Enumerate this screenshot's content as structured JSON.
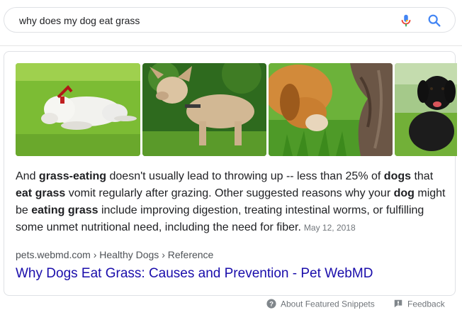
{
  "search": {
    "query": "why does my dog eat grass",
    "mic_icon": "microphone-icon",
    "search_icon": "magnifier-icon",
    "colors": {
      "mic_blue": "#4285f4",
      "mic_red": "#ea4335",
      "mic_yellow": "#fbbc04",
      "mic_green": "#34a853",
      "search_blue": "#4285f4"
    }
  },
  "featured_snippet": {
    "images": [
      {
        "subject": "white dog lying on grass with red collar"
      },
      {
        "subject": "tan dog with collar standing in grass"
      },
      {
        "subject": "beagle sniffing grass near tree trunk"
      },
      {
        "subject": "black dog sitting on lawn"
      }
    ],
    "text_parts": [
      {
        "t": "And ",
        "bold": false
      },
      {
        "t": "grass-eating",
        "bold": true
      },
      {
        "t": " doesn't usually lead to throwing up -- less than 25% of ",
        "bold": false
      },
      {
        "t": "dogs",
        "bold": true
      },
      {
        "t": " that ",
        "bold": false
      },
      {
        "t": "eat grass",
        "bold": true
      },
      {
        "t": " vomit regularly after grazing. Other suggested reasons why your ",
        "bold": false
      },
      {
        "t": "dog",
        "bold": true
      },
      {
        "t": " might be ",
        "bold": false
      },
      {
        "t": "eating grass",
        "bold": true
      },
      {
        "t": " include improving digestion, treating intestinal worms, or fulfilling some unmet nutritional need, including the need for fiber.",
        "bold": false
      }
    ],
    "date": "May 12, 2018",
    "breadcrumb": "pets.webmd.com › Healthy Dogs › Reference",
    "title": "Why Dogs Eat Grass: Causes and Prevention - Pet WebMD",
    "link_color": "#1a0dab"
  },
  "footer": {
    "about_label": "About Featured Snippets",
    "about_icon": "help-circle-icon",
    "feedback_label": "Feedback",
    "feedback_icon": "feedback-flag-icon"
  }
}
